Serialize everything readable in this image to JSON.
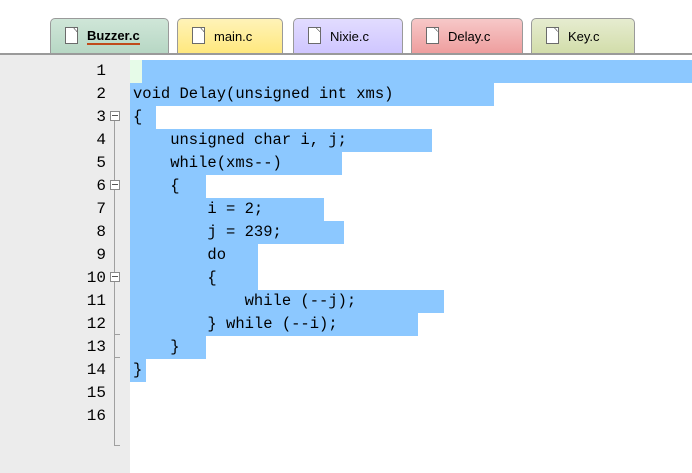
{
  "tabs": [
    {
      "label": "Buzzer.c",
      "active": true,
      "color": "#b7d7c4"
    },
    {
      "label": "main.c",
      "active": false,
      "color": "#ffe87e"
    },
    {
      "label": "Nixie.c",
      "active": false,
      "color": "#cfc6ff"
    },
    {
      "label": "Delay.c",
      "active": false,
      "color": "#ee9e9e"
    },
    {
      "label": "Key.c",
      "active": false,
      "color": "#d2ddaa"
    }
  ],
  "editor": {
    "selection_color": "#8cc8ff",
    "current_line_color": "#e6fbe8",
    "lines": [
      {
        "num": "1",
        "text": ""
      },
      {
        "num": "2",
        "text": "void Delay(unsigned int xms)"
      },
      {
        "num": "3",
        "text": "{"
      },
      {
        "num": "4",
        "text": "    unsigned char i, j;"
      },
      {
        "num": "5",
        "text": "    while(xms--)"
      },
      {
        "num": "6",
        "text": "    {"
      },
      {
        "num": "7",
        "text": "        i = 2;"
      },
      {
        "num": "8",
        "text": "        j = 239;"
      },
      {
        "num": "9",
        "text": "        do"
      },
      {
        "num": "10",
        "text": "        {"
      },
      {
        "num": "11",
        "text": "            while (--j);"
      },
      {
        "num": "12",
        "text": "        } while (--i);"
      },
      {
        "num": "13",
        "text": "    }"
      },
      {
        "num": "14",
        "text": "}"
      },
      {
        "num": "15",
        "text": ""
      },
      {
        "num": "16",
        "text": ""
      }
    ]
  }
}
